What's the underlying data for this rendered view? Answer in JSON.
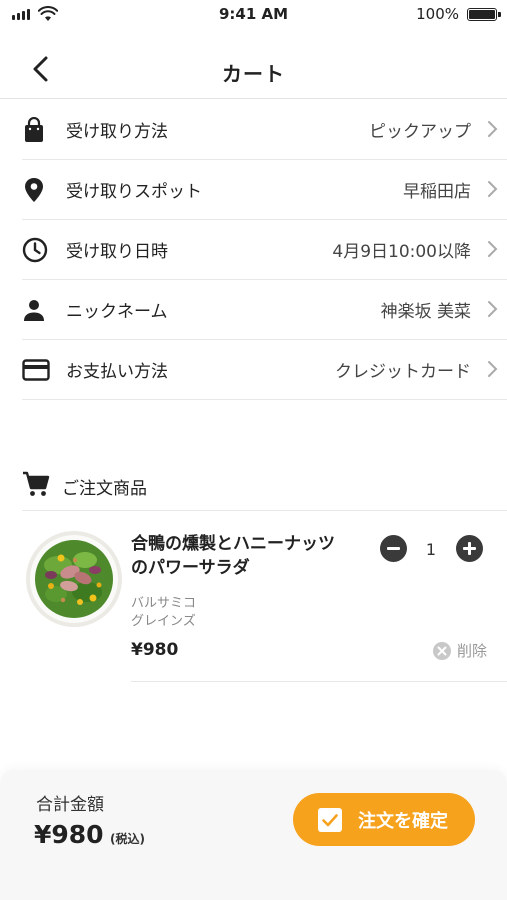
{
  "status_bar": {
    "time": "9:41 AM",
    "battery": "100%"
  },
  "nav": {
    "title": "カート"
  },
  "settings": [
    {
      "label": "受け取り方法",
      "value": "ピックアップ",
      "icon": "shopping-bag-icon"
    },
    {
      "label": "受け取りスポット",
      "value": "早稲田店",
      "icon": "location-pin-icon"
    },
    {
      "label": "受け取り日時",
      "value": "4月9日10:00以降",
      "icon": "clock-icon"
    },
    {
      "label": "ニックネーム",
      "value": "神楽坂 美菜",
      "icon": "person-icon"
    },
    {
      "label": "お支払い方法",
      "value": "クレジットカード",
      "icon": "credit-card-icon"
    }
  ],
  "items_section": {
    "label": "ご注文商品",
    "icon": "cart-icon"
  },
  "product": {
    "name_line1": "合鴨の燻製とハニーナッツ",
    "name_line2": "のパワーサラダ",
    "option1": "バルサミコ",
    "option2": "グレインズ",
    "price": "¥980",
    "quantity": "1",
    "delete_label": "削除"
  },
  "footer": {
    "total_label": "合計金額",
    "total_amount": "¥980",
    "tax_note": "(税込)",
    "confirm_label": "注文を確定"
  },
  "colors": {
    "accent": "#f6a21d",
    "text": "#222222",
    "muted": "#999999"
  }
}
